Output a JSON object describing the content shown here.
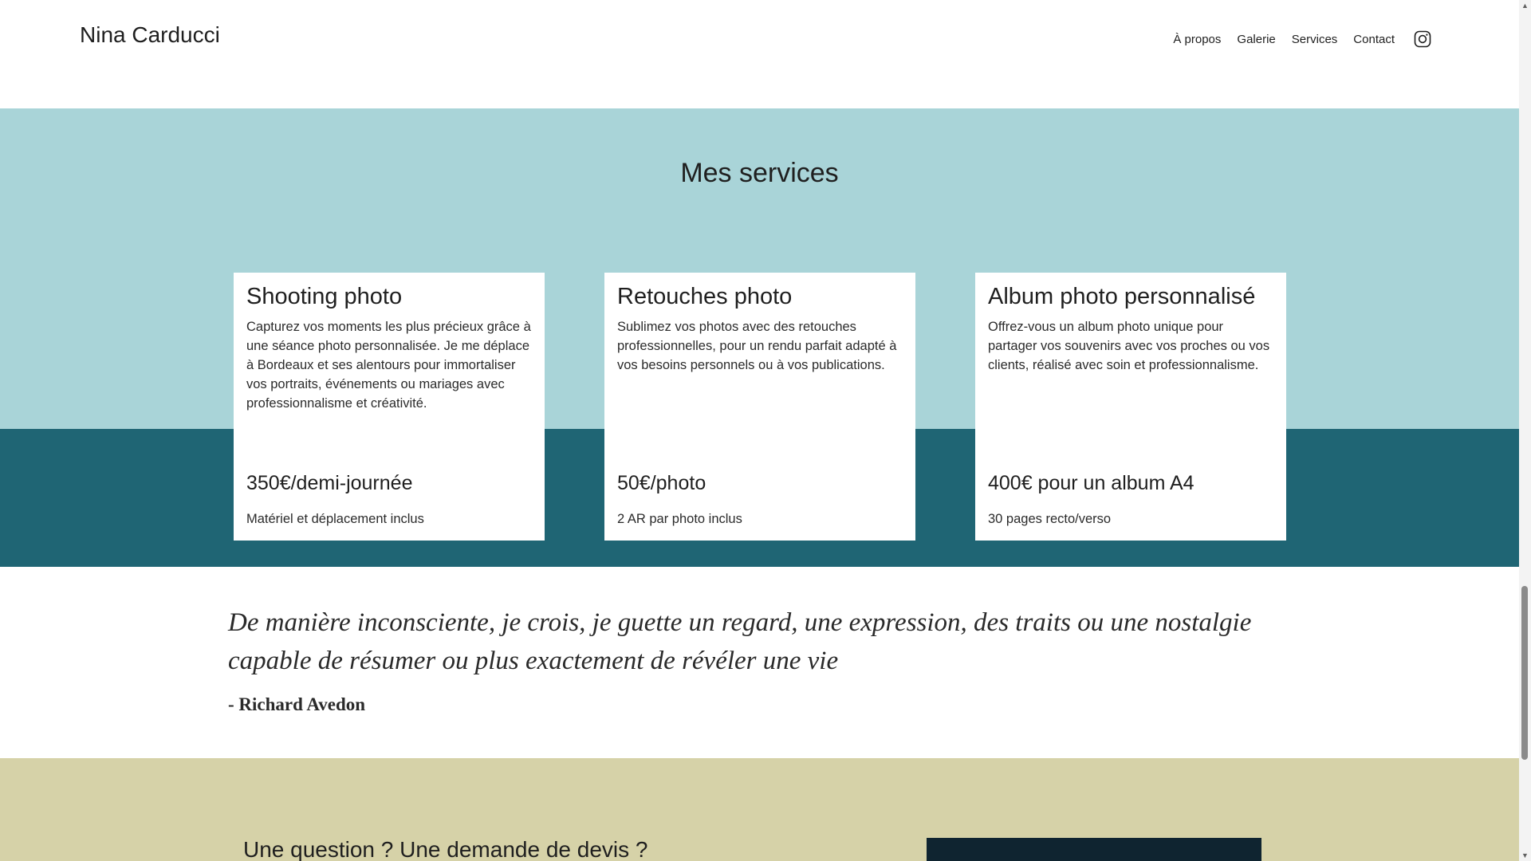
{
  "header": {
    "brand": "Nina Carducci",
    "nav": [
      "À propos",
      "Galerie",
      "Services",
      "Contact"
    ],
    "instagram_icon": "instagram-icon"
  },
  "services": {
    "title": "Mes services",
    "colors": {
      "light_band": "#a9d4d8",
      "dark_band": "#1f6574"
    },
    "cards": [
      {
        "title": "Shooting photo",
        "description": "Capturez vos moments les plus précieux grâce à une séance photo personnalisée. Je me déplace à Bordeaux et ses alentours pour immortaliser vos portraits, événements ou mariages avec professionnalisme et créativité.",
        "price": "350€/demi-journée",
        "note": "Matériel et déplacement inclus"
      },
      {
        "title": "Retouches photo",
        "description": "Sublimez vos photos avec des retouches professionnelles, pour un rendu parfait adapté à vos besoins personnels ou à vos publications.",
        "price": "50€/photo",
        "note": "2 AR par photo inclus"
      },
      {
        "title": "Album photo personnalisé",
        "description": "Offrez-vous un album photo unique pour partager vos souvenirs avec vos proches ou vos clients, réalisé avec soin et professionnalisme.",
        "price": "400€ pour un album A4",
        "note": "30 pages recto/verso"
      }
    ]
  },
  "quote": {
    "text": "De manière inconsciente, je crois, je guette un regard, une expression, des traits ou une nostalgie capable de résumer ou plus exactement de révéler une vie",
    "author": "- Richard Avedon"
  },
  "contact": {
    "heading": "Une question ? Une demande de devis ?",
    "background": "#d6d2a8"
  },
  "scrollbar": {
    "up_icon": "▲",
    "down_icon": "▼"
  }
}
